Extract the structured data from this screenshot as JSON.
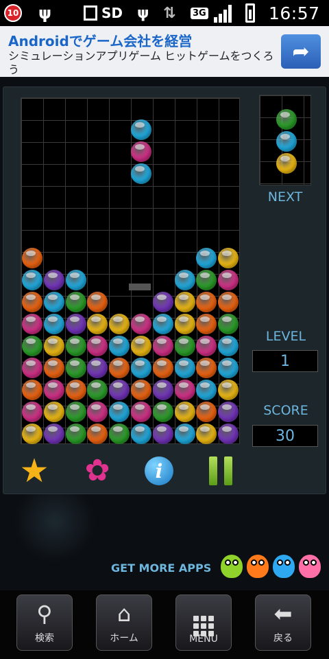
{
  "statusbar": {
    "badge": "10",
    "sd": "SD",
    "network": "3G",
    "time": "16:57"
  },
  "ad": {
    "title": "Androidでゲーム会社を経営",
    "subtitle": "シミュレーションアプリゲーム ヒットゲームをつくろう"
  },
  "board": {
    "columns": 10,
    "rows": 16,
    "ball_colors": {
      "O": "#ff6a10",
      "B": "#20b6ee",
      "P": "#7a36c6",
      "G": "#2ca82a",
      "Y": "#ffc612",
      "M": "#e0318f"
    },
    "falling_piece": [
      "B",
      "M",
      "B"
    ],
    "stack": [
      "O........BY",
      "BPB....B.GM",
      "OBGO..PY.OO",
      "MBPYYMBYOG",
      "GYGMBYMGMB",
      "MOGPOBOBOB",
      "OMOGPOPMBY",
      "MYGMBMGYOP",
      "YPGOGBPBYP"
    ]
  },
  "next_piece": [
    "G",
    "B",
    "Y"
  ],
  "labels": {
    "next": "NEXT",
    "level": "LEVEL",
    "score": "SCORE",
    "get_more": "GET MORE APPS"
  },
  "stats": {
    "level": "1",
    "score": "30"
  },
  "critters": [
    "#8fd22b",
    "#ff7a1a",
    "#2ea8f0",
    "#ff6fa8"
  ],
  "navbar": {
    "search": "検索",
    "home": "ホーム",
    "menu": "MENU",
    "back": "戻る"
  }
}
